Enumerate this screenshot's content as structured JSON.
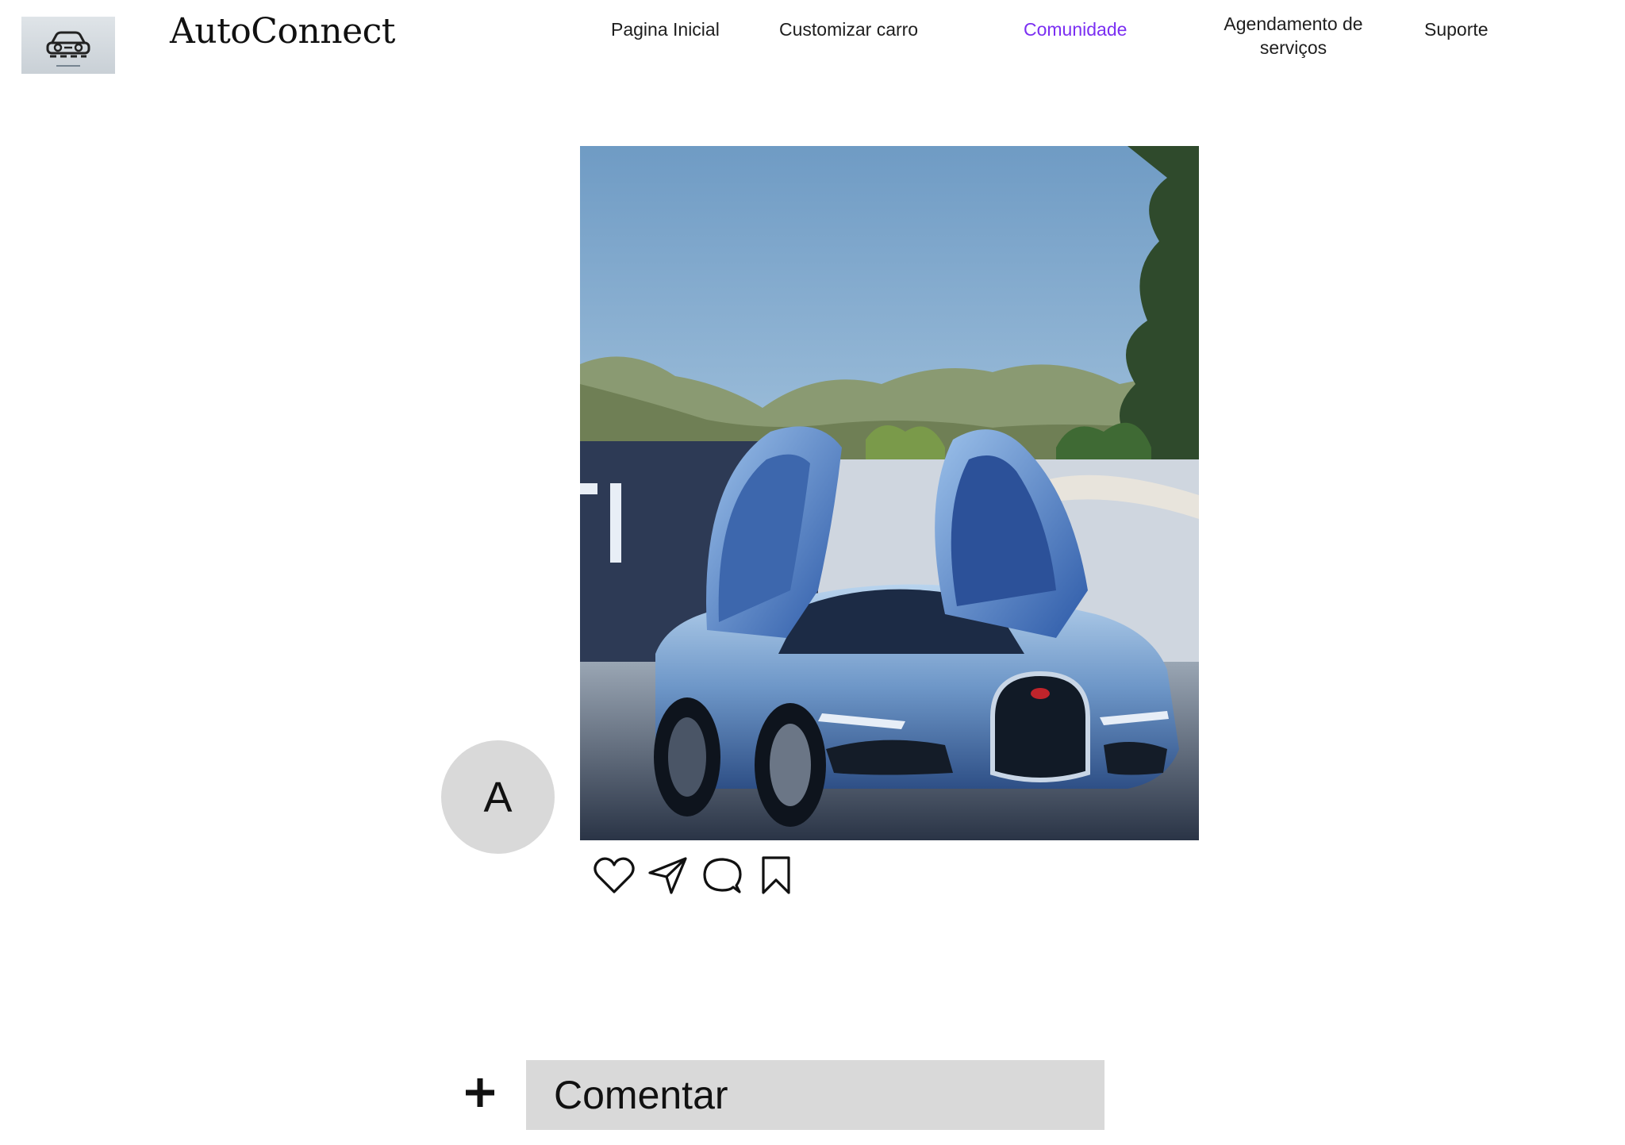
{
  "header": {
    "logo_icon": "car-icon",
    "brand": "AutoConnect",
    "nav": [
      {
        "label": "Pagina Inicial",
        "active": false
      },
      {
        "label": "Customizar carro",
        "active": false
      },
      {
        "label": "Comunidade",
        "active": true
      },
      {
        "label": "Agendamento de serviços",
        "active": false
      },
      {
        "label": "Suporte",
        "active": false
      }
    ],
    "active_color": "#7b2ff2"
  },
  "post": {
    "image_subject": "car-photo",
    "avatar_initial": "A",
    "actions": [
      {
        "icon": "heart-icon"
      },
      {
        "icon": "send-icon"
      },
      {
        "icon": "comment-icon"
      },
      {
        "icon": "bookmark-icon"
      }
    ]
  },
  "comment": {
    "add_icon": "plus-icon",
    "label": "Comentar"
  }
}
